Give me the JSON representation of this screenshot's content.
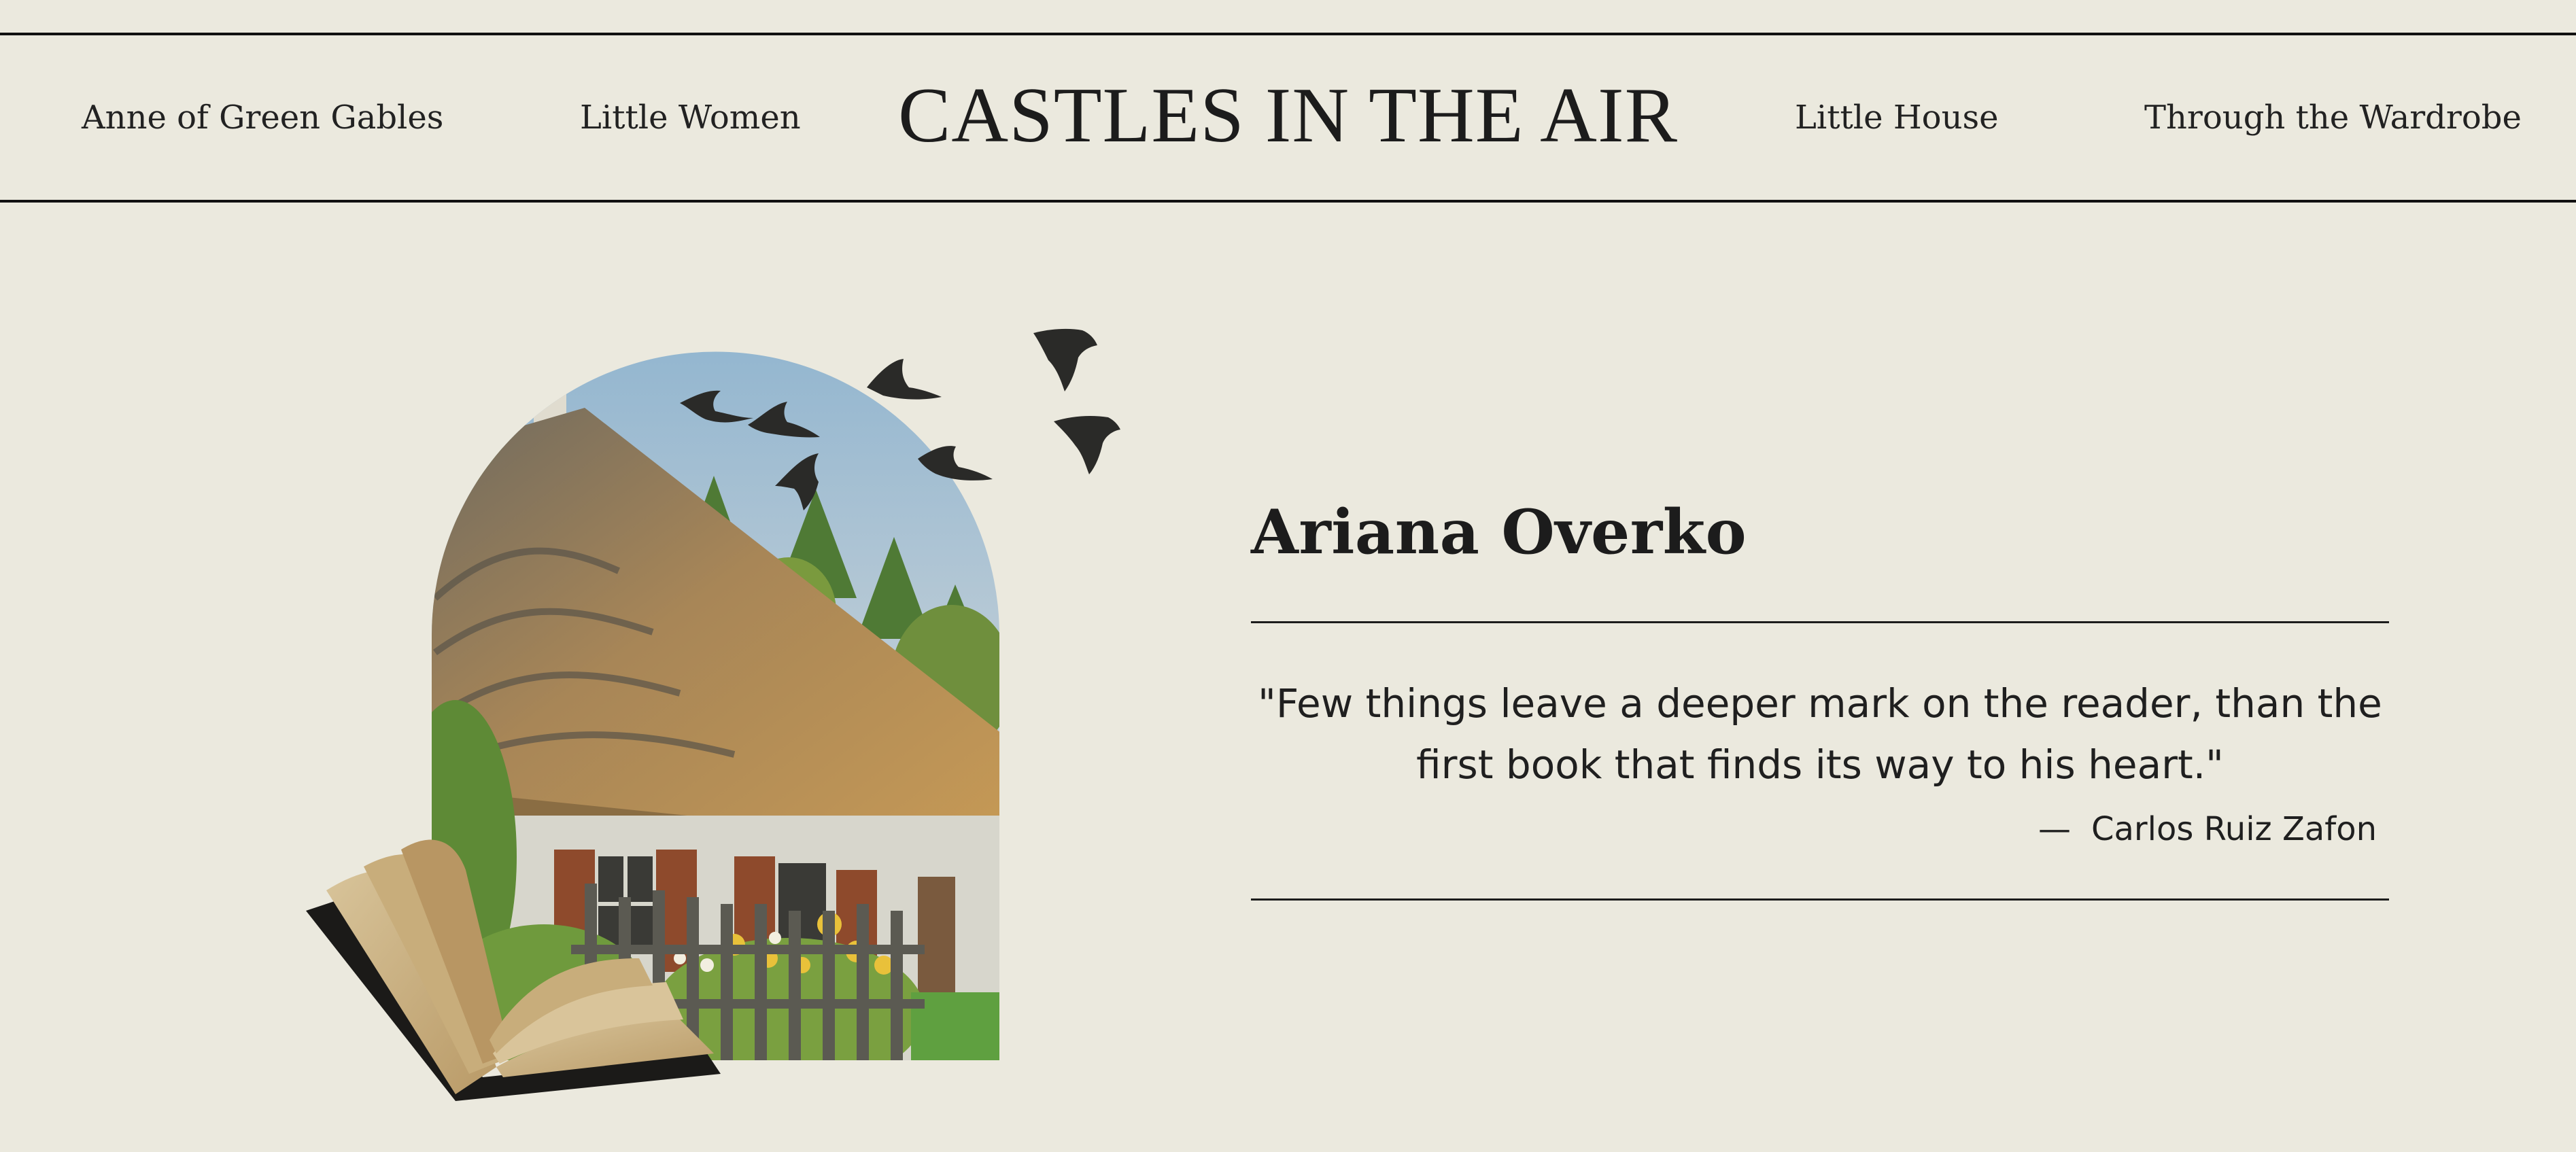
{
  "header": {
    "nav_left": [
      {
        "label": "Anne of Green Gables"
      },
      {
        "label": "Little Women"
      }
    ],
    "title": "CASTLES IN THE AIR",
    "nav_right": [
      {
        "label": "Little House"
      },
      {
        "label": "Through the Wardrobe"
      }
    ]
  },
  "author": {
    "name": "Ariana Overko",
    "quote": "\"Few things leave a deeper mark on the reader, than the first book that finds its way to his heart.\"",
    "quote_dash": "—",
    "quote_author": "Carlos Ruiz Zafon"
  },
  "hero": {
    "image": "thatched-cottage-arch-with-open-book-and-birds-illustration"
  },
  "colors": {
    "background": "#ebe9de",
    "text": "#1f1f1f",
    "rule": "#1c1c1c"
  }
}
